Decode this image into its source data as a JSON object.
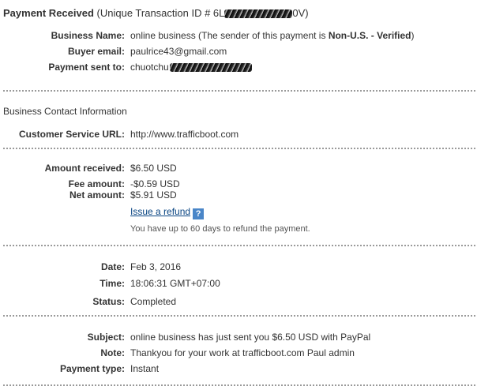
{
  "header": {
    "title": "Payment Received",
    "transaction_prefix": "(Unique Transaction ID # 6L",
    "transaction_suffix": "0V)"
  },
  "payment": {
    "business_name_label": "Business Name:",
    "business_name_value": "online business (The sender of this payment is ",
    "business_status": "Non-U.S. - Verified",
    "business_name_close": ")",
    "buyer_email_label": "Buyer email:",
    "buyer_email_value": "paulrice43@gmail.com",
    "sent_to_label": "Payment sent to:",
    "sent_to_value": "chuotchu"
  },
  "contact": {
    "heading": "Business Contact Information",
    "service_url_label": "Customer Service URL:",
    "service_url_value": "http://www.trafficboot.com"
  },
  "amounts": {
    "received_label": "Amount received:",
    "received_value": "$6.50 USD",
    "fee_label": "Fee amount:",
    "fee_value": "-$0.59 USD",
    "net_label": "Net amount:",
    "net_value": "$5.91 USD",
    "refund_link": "Issue a refund",
    "help_icon_glyph": "?",
    "refund_note": "You have up to 60 days to refund the payment."
  },
  "details": {
    "date_label": "Date:",
    "date_value": "Feb 3, 2016",
    "time_label": "Time:",
    "time_value": "18:06:31 GMT+07:00",
    "status_label": "Status:",
    "status_value": "Completed"
  },
  "message": {
    "subject_label": "Subject:",
    "subject_value": "online business has just sent you $6.50 USD with PayPal",
    "note_label": "Note:",
    "note_value": "Thankyou for your work at trafficboot.com Paul admin",
    "type_label": "Payment type:",
    "type_value": "Instant"
  },
  "colors": {
    "text": "#333333",
    "link": "#084482",
    "help_icon_bg": "#4a86c8",
    "separator": "#9a9a9a"
  }
}
